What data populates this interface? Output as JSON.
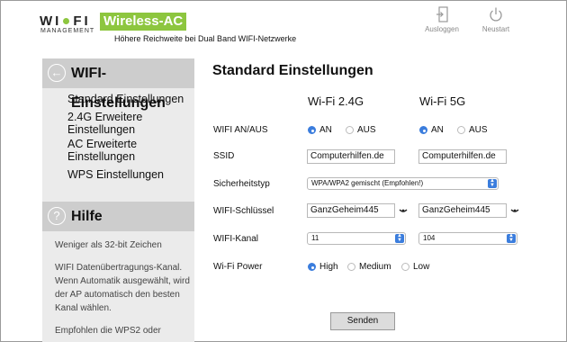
{
  "header": {
    "logo_text_a": "WI",
    "logo_text_b": "FI",
    "logo_sub": "MANAGEMENT",
    "brand": "Wireless-AC",
    "tagline": "Höhere Reichweite bei Dual Band WIFI-Netzwerke",
    "logout_label": "Ausloggen",
    "restart_label": "Neustart"
  },
  "sidebar": {
    "section_title": "WIFI-Einstellungen",
    "items": [
      {
        "label": "Standard Einstellungen"
      },
      {
        "label": "2.4G Erweitere Einstellungen"
      },
      {
        "label": "AC Erweiterte Einstellungen"
      },
      {
        "label": "WPS Einstellungen"
      }
    ],
    "help_title": "Hilfe",
    "help_paragraphs": [
      "Weniger als 32-bit Zeichen",
      "WIFI Datenübertragungs-Kanal. Wenn Automatik ausgewählt, wird der AP automatisch den besten Kanal wählen.",
      "Empfohlen die WPS2 oder"
    ]
  },
  "main": {
    "title": "Standard Einstellungen",
    "col_24": "Wi-Fi 2.4G",
    "col_5": "Wi-Fi 5G",
    "labels": {
      "wifi_onoff": "WIFI AN/AUS",
      "ssid": "SSID",
      "security": "Sicherheitstyp",
      "key": "WIFI-Schlüssel",
      "channel": "WIFI-Kanal",
      "power": "Wi-Fi Power"
    },
    "on_label": "AN",
    "off_label": "AUS",
    "ssid_24": "Computerhilfen.de",
    "ssid_5": "Computerhilfen.de",
    "security_value": "WPA/WPA2 gemischt (Empfohlen!)",
    "key_24": "GanzGeheim445",
    "key_5": "GanzGeheim445",
    "channel_24": "11",
    "channel_5": "104",
    "power_high": "High",
    "power_medium": "Medium",
    "power_low": "Low",
    "send_label": "Senden"
  },
  "colors": {
    "brand_green": "#8dc63f",
    "accent_blue": "#3b7ddd",
    "sidebar_header": "#cdcdcd",
    "sidebar_bg": "#ebebeb"
  }
}
